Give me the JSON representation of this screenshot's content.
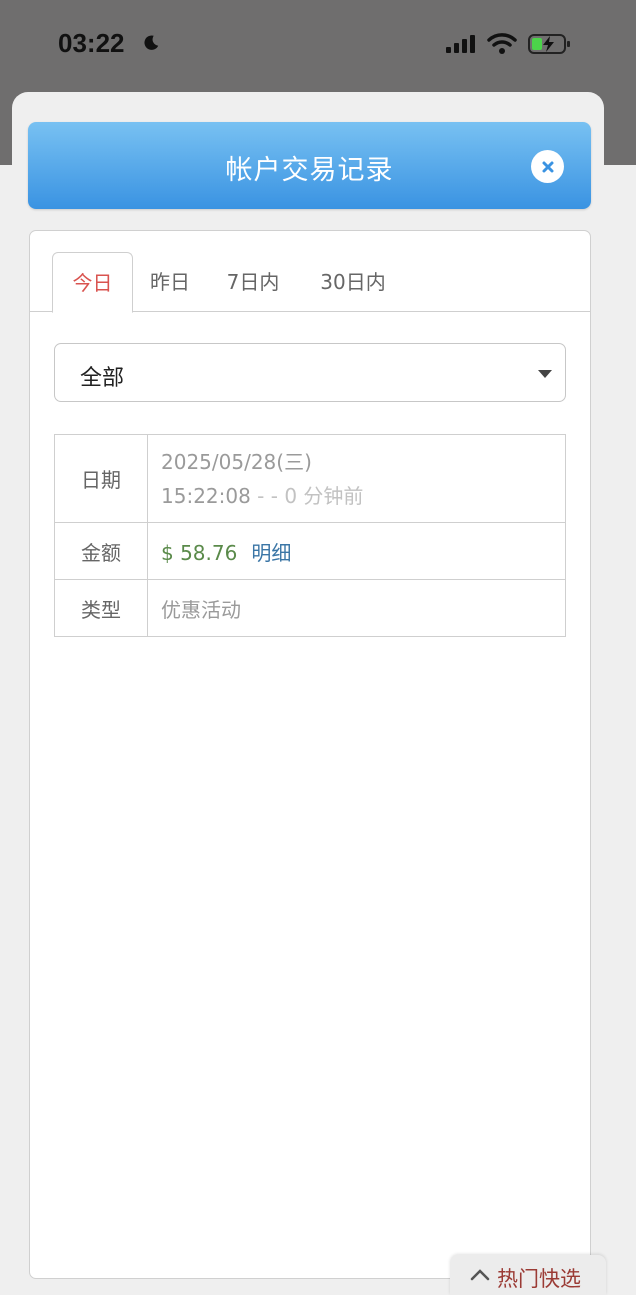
{
  "status_bar": {
    "time": "03:22",
    "icons": [
      "moon-icon",
      "signal-icon",
      "wifi-icon",
      "battery-charging-icon"
    ]
  },
  "modal": {
    "title": "帐户交易记录",
    "close_icon": "close-icon",
    "accent_color": "#3a93e2"
  },
  "tabs": [
    {
      "label": "今日",
      "active": true
    },
    {
      "label": "昨日",
      "active": false
    },
    {
      "label": "7日内",
      "active": false
    },
    {
      "label": "30日内",
      "active": false
    }
  ],
  "filter": {
    "selected": "全部"
  },
  "record": {
    "date_label": "日期",
    "date_value": "2025/05/28(三)",
    "time_value": "15:22:08",
    "relative_time": " - - 0 分钟前",
    "amount_label": "金额",
    "amount_value": "$ 58.76",
    "detail_link": "明细",
    "type_label": "类型",
    "type_value": "优惠活动"
  },
  "hot_pick": {
    "label": "热门快选",
    "icon": "chevron-up-icon"
  },
  "colors": {
    "active_tab": "#d9534f",
    "amount": "#5a8a4a",
    "link": "#3b76a6"
  }
}
